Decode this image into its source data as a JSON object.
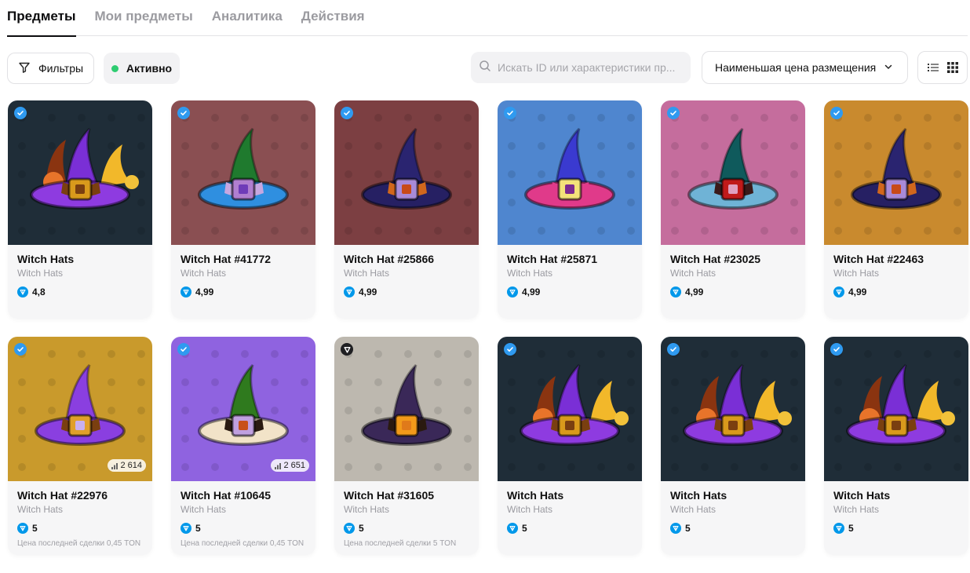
{
  "tabs": [
    {
      "label": "Предметы",
      "active": true
    },
    {
      "label": "Мои предметы",
      "active": false
    },
    {
      "label": "Аналитика",
      "active": false
    },
    {
      "label": "Действия",
      "active": false
    }
  ],
  "toolbar": {
    "filters_label": "Фильтры",
    "status_label": "Активно",
    "status_color": "#2ecc71",
    "search_placeholder": "Искать ID или характеристики пр...",
    "sort_label": "Наименьшая цена размещения",
    "icons": [
      "filter-icon",
      "search-icon",
      "chevron-down-icon",
      "list-view-icon",
      "grid-view-icon"
    ]
  },
  "accent": "#0098ea",
  "cards": [
    {
      "title": "Witch Hats",
      "collection": "Witch Hats",
      "price": "4,8",
      "bg": "#1f2d38",
      "hat": "group",
      "badge": "blue",
      "count": "",
      "last_sale": ""
    },
    {
      "title": "Witch Hat #41772",
      "collection": "Witch Hats",
      "price": "4,99",
      "bg": "#8a4f52",
      "hat": "green",
      "badge": "blue",
      "count": "",
      "last_sale": ""
    },
    {
      "title": "Witch Hat #25866",
      "collection": "Witch Hats",
      "price": "4,99",
      "bg": "#7c3f42",
      "hat": "navy",
      "badge": "blue",
      "count": "",
      "last_sale": ""
    },
    {
      "title": "Witch Hat #25871",
      "collection": "Witch Hats",
      "price": "4,99",
      "bg": "#4f86cf",
      "hat": "blue",
      "badge": "blue",
      "count": "",
      "last_sale": ""
    },
    {
      "title": "Witch Hat #23025",
      "collection": "Witch Hats",
      "price": "4,99",
      "bg": "#c56d9d",
      "hat": "teal",
      "badge": "blue",
      "count": "",
      "last_sale": ""
    },
    {
      "title": "Witch Hat #22463",
      "collection": "Witch Hats",
      "price": "4,99",
      "bg": "#c98a2e",
      "hat": "navy",
      "badge": "blue",
      "count": "",
      "last_sale": ""
    },
    {
      "title": "Witch Hat #22976",
      "collection": "Witch Hats",
      "price": "5",
      "bg": "#c99a2c",
      "hat": "purple",
      "badge": "blue",
      "count": "2 614",
      "last_sale": "Цена последней сделки 0,45 TON"
    },
    {
      "title": "Witch Hat #10645",
      "collection": "Witch Hats",
      "price": "5",
      "bg": "#8f63e0",
      "hat": "green2",
      "badge": "blue",
      "count": "2 651",
      "last_sale": "Цена последней сделки 0,45 TON"
    },
    {
      "title": "Witch Hat #31605",
      "collection": "Witch Hats",
      "price": "5",
      "bg": "#bdb8af",
      "hat": "dark",
      "badge": "dark",
      "count": "",
      "last_sale": "Цена последней сделки 5 TON"
    },
    {
      "title": "Witch Hats",
      "collection": "Witch Hats",
      "price": "5",
      "bg": "#1f2d38",
      "hat": "group",
      "badge": "blue",
      "count": "",
      "last_sale": ""
    },
    {
      "title": "Witch Hats",
      "collection": "Witch Hats",
      "price": "5",
      "bg": "#1f2d38",
      "hat": "group",
      "badge": "blue",
      "count": "",
      "last_sale": ""
    },
    {
      "title": "Witch Hats",
      "collection": "Witch Hats",
      "price": "5",
      "bg": "#1f2d38",
      "hat": "group",
      "badge": "blue",
      "count": "",
      "last_sale": ""
    }
  ],
  "hat_colors": {
    "group": {
      "cone": "#7a2fd6",
      "brim": "#8e3be0",
      "band": "#7a3f10",
      "buckle": "#d99a1c",
      "inner": "#7a3f10"
    },
    "green": {
      "cone": "#1f7a2e",
      "brim": "#2f8fe0",
      "band": "#c7a7e0",
      "buckle": "#b07fd0",
      "inner": "#6e3cb8"
    },
    "navy": {
      "cone": "#2a2470",
      "brim": "#262063",
      "band": "#d1671c",
      "buckle": "#a88ad8",
      "inner": "#c84a18"
    },
    "blue": {
      "cone": "#3a3ad0",
      "brim": "#e03a8a",
      "band": "#e03a8a",
      "buckle": "#f3e27a",
      "inner": "#7a2a90"
    },
    "teal": {
      "cone": "#0f5a5c",
      "brim": "#6fb3d6",
      "band": "#3a1a1a",
      "buckle": "#c01a1a",
      "inner": "#e0a0c0"
    },
    "purple": {
      "cone": "#8a3fe0",
      "brim": "#8a3fe0",
      "band": "#7a3f10",
      "buckle": "#e0a02a",
      "inner": "#c8b0f0"
    },
    "green2": {
      "cone": "#2f7a1e",
      "brim": "#f2e3c8",
      "band": "#2a1a10",
      "buckle": "#c0a0e0",
      "inner": "#c8501a"
    },
    "dark": {
      "cone": "#3a2858",
      "brim": "#3a2858",
      "band": "#2a1a10",
      "buckle": "#f29a1a",
      "inner": "#e07a1a"
    }
  }
}
